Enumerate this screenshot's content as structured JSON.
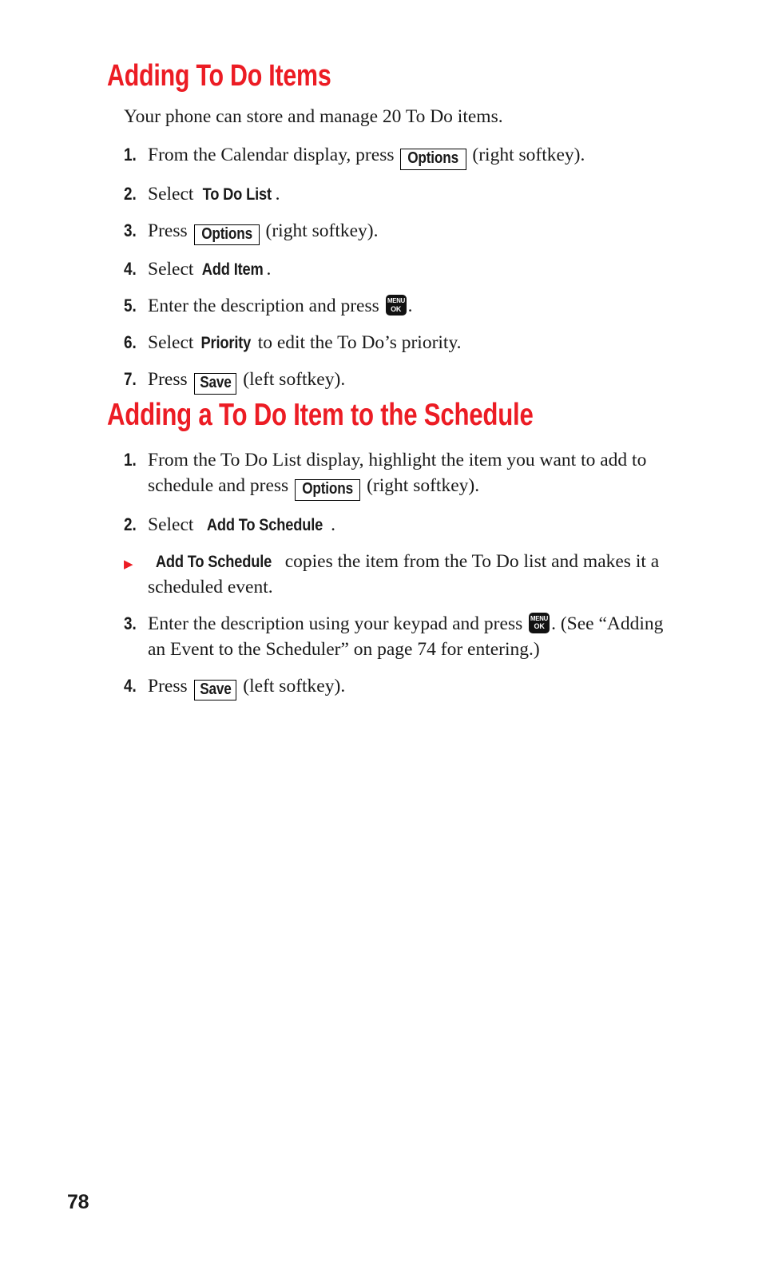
{
  "page": {
    "number": "78",
    "accent_color": "#ec1c24",
    "text_color": "#1a1a1a",
    "background_color": "#ffffff"
  },
  "sections": [
    {
      "heading": "Adding To Do Items",
      "intro": "Your phone can store and manage 20 To Do items.",
      "steps": [
        {
          "marker": "1.",
          "text_runs": [
            {
              "t": "plain",
              "v": "From the Calendar display, press "
            },
            {
              "t": "softkey",
              "v": "Options"
            },
            {
              "t": "plain",
              "v": " (right softkey)."
            }
          ]
        },
        {
          "marker": "2.",
          "text_runs": [
            {
              "t": "plain",
              "v": "Select "
            },
            {
              "t": "ui",
              "v": "To Do List"
            },
            {
              "t": "plain",
              "v": "."
            }
          ]
        },
        {
          "marker": "3.",
          "text_runs": [
            {
              "t": "plain",
              "v": "Press "
            },
            {
              "t": "softkey",
              "v": "Options"
            },
            {
              "t": "plain",
              "v": " (right softkey)."
            }
          ]
        },
        {
          "marker": "4.",
          "text_runs": [
            {
              "t": "plain",
              "v": "Select "
            },
            {
              "t": "ui",
              "v": "Add Item"
            },
            {
              "t": "plain",
              "v": "."
            }
          ]
        },
        {
          "marker": "5.",
          "text_runs": [
            {
              "t": "plain",
              "v": "Enter the description and press "
            },
            {
              "t": "menukey",
              "v": "MENU OK"
            },
            {
              "t": "plain",
              "v": "."
            }
          ]
        },
        {
          "marker": "6.",
          "text_runs": [
            {
              "t": "plain",
              "v": "Select "
            },
            {
              "t": "ui",
              "v": "Priority"
            },
            {
              "t": "plain",
              "v": " to edit the To Do’s priority."
            }
          ]
        },
        {
          "marker": "7.",
          "text_runs": [
            {
              "t": "plain",
              "v": "Press "
            },
            {
              "t": "softkey",
              "v": "Save"
            },
            {
              "t": "plain",
              "v": " (left softkey)."
            }
          ]
        }
      ]
    },
    {
      "heading": "Adding a To Do Item to the Schedule",
      "steps": [
        {
          "marker": "1.",
          "text_runs": [
            {
              "t": "plain",
              "v": "From the To Do List display, highlight the item you want to add to schedule and press "
            },
            {
              "t": "softkey",
              "v": "Options"
            },
            {
              "t": "plain",
              "v": " (right softkey)."
            }
          ]
        },
        {
          "marker": "2.",
          "text_runs": [
            {
              "t": "plain",
              "v": "Select "
            },
            {
              "t": "ui",
              "v": "Add To Schedule"
            },
            {
              "t": "plain",
              "v": "."
            }
          ]
        },
        {
          "marker": "▶",
          "note": true,
          "text_runs": [
            {
              "t": "ui",
              "v": "Add To Schedule"
            },
            {
              "t": "plain",
              "v": " copies the item from the To Do list and makes it a scheduled event."
            }
          ]
        },
        {
          "marker": "3.",
          "text_runs": [
            {
              "t": "plain",
              "v": "Enter the description using your keypad and press "
            },
            {
              "t": "menukey",
              "v": "MENU OK"
            },
            {
              "t": "plain",
              "v": ". (See “Adding an Event to the Scheduler” on page 74 for entering.)"
            }
          ]
        },
        {
          "marker": "4.",
          "text_runs": [
            {
              "t": "plain",
              "v": "Press "
            },
            {
              "t": "softkey",
              "v": "Save"
            },
            {
              "t": "plain",
              "v": " (left softkey)."
            }
          ]
        }
      ]
    }
  ],
  "menu_key": {
    "line1": "MENU",
    "line2": "OK"
  }
}
